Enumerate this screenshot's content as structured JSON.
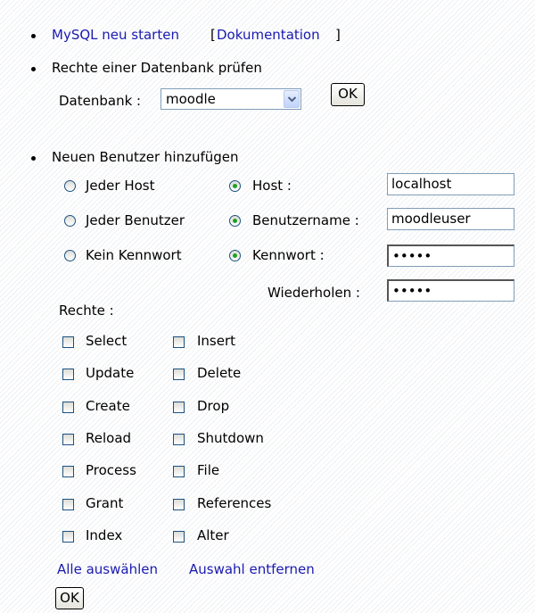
{
  "links": {
    "restart": "MySQL neu starten",
    "doc_open": "[",
    "doc": "Dokumentation",
    "doc_close": "]"
  },
  "check_section": {
    "title": "Rechte einer Datenbank prüfen",
    "db_label": "Datenbank :",
    "db_value": "moodle",
    "ok": "OK"
  },
  "user_section": {
    "title": "Neuen Benutzer hinzufügen",
    "radios": [
      {
        "left": "Jeder Host",
        "right": "Host :",
        "value": "localhost",
        "right_checked": true
      },
      {
        "left": "Jeder Benutzer",
        "right": "Benutzername :",
        "value": "moodleuser",
        "right_checked": true
      },
      {
        "left": "Kein Kennwort",
        "right": "Kennwort :",
        "value": "•••••",
        "right_checked": true
      }
    ],
    "repeat_label": "Wiederholen :",
    "repeat_value": "•••••",
    "rights_label": "Rechte :",
    "privileges": [
      [
        "Select",
        "Insert"
      ],
      [
        "Update",
        "Delete"
      ],
      [
        "Create",
        "Drop"
      ],
      [
        "Reload",
        "Shutdown"
      ],
      [
        "Process",
        "File"
      ],
      [
        "Grant",
        "References"
      ],
      [
        "Index",
        "Alter"
      ]
    ],
    "select_all": "Alle auswählen",
    "deselect_all": "Auswahl entfernen",
    "ok": "OK"
  }
}
